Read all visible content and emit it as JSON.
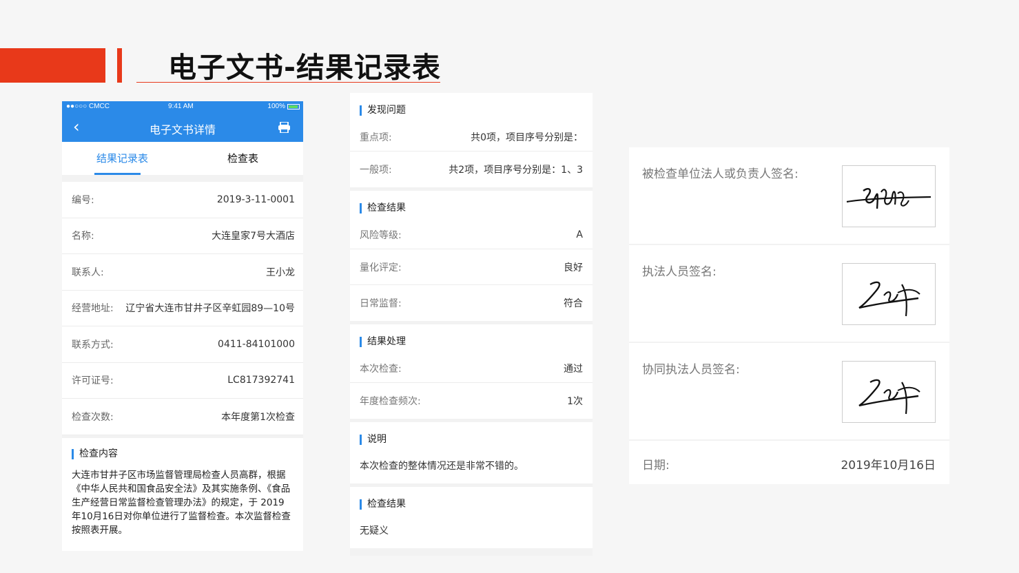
{
  "slide": {
    "title": "电子文书-结果记录表"
  },
  "phone": {
    "status": {
      "carrier": "●●○○○ CMCC",
      "time": "9:41 AM",
      "battery": "100%"
    },
    "nav": {
      "title": "电子文书详情",
      "back_icon": "chevron-left-icon",
      "print_icon": "printer-icon"
    },
    "tabs": [
      {
        "label": "结果记录表",
        "active": true
      },
      {
        "label": "检查表",
        "active": false
      }
    ],
    "fields": [
      {
        "label": "编号:",
        "value": "2019-3-11-0001"
      },
      {
        "label": "名称:",
        "value": "大连皇家7号大酒店"
      },
      {
        "label": "联系人:",
        "value": "王小龙"
      },
      {
        "label": "经营地址:",
        "value": "辽宁省大连市甘井子区辛虹园89—10号"
      },
      {
        "label": "联系方式:",
        "value": "0411-84101000"
      },
      {
        "label": "许可证号:",
        "value": "LC817392741"
      },
      {
        "label": "检查次数:",
        "value": "本年度第1次检查"
      }
    ],
    "content": {
      "title": "检查内容",
      "text": " 大连市甘井子区市场监督管理局检查人员高群，根据《中华人民共和国食品安全法》及其实施条例、《食品生产经营日常监督检查管理办法》的规定，于 2019年10月16日对你单位进行了监督检查。本次监督检查按照表开展。"
    }
  },
  "middle": {
    "problems": {
      "title": "发现问题",
      "rows": [
        {
          "label": "重点项:",
          "value": "共0项，项目序号分别是："
        },
        {
          "label": "一般项:",
          "value": "共2项，项目序号分别是：1、3"
        }
      ]
    },
    "result": {
      "title": "检查结果",
      "rows": [
        {
          "label": "风险等级:",
          "value": "A"
        },
        {
          "label": "量化评定:",
          "value": "良好"
        },
        {
          "label": "日常监督:",
          "value": "符合"
        }
      ]
    },
    "handling": {
      "title": "结果处理",
      "rows": [
        {
          "label": "本次检查:",
          "value": "通过"
        },
        {
          "label": "年度检查频次:",
          "value": "1次"
        }
      ]
    },
    "note": {
      "title": "说明",
      "text": "本次检查的整体情况还是非常不错的。"
    },
    "final": {
      "title": "检查结果",
      "text": "无疑义"
    }
  },
  "signatures": {
    "rows": [
      {
        "label": "被检查单位法人或负责人签名:"
      },
      {
        "label": "执法人员签名:"
      },
      {
        "label": "协同执法人员签名:"
      }
    ],
    "date_label": "日期:",
    "date_value": "2019年10月16日"
  },
  "colors": {
    "accent": "#e8391a",
    "primary": "#2b8ae8"
  }
}
